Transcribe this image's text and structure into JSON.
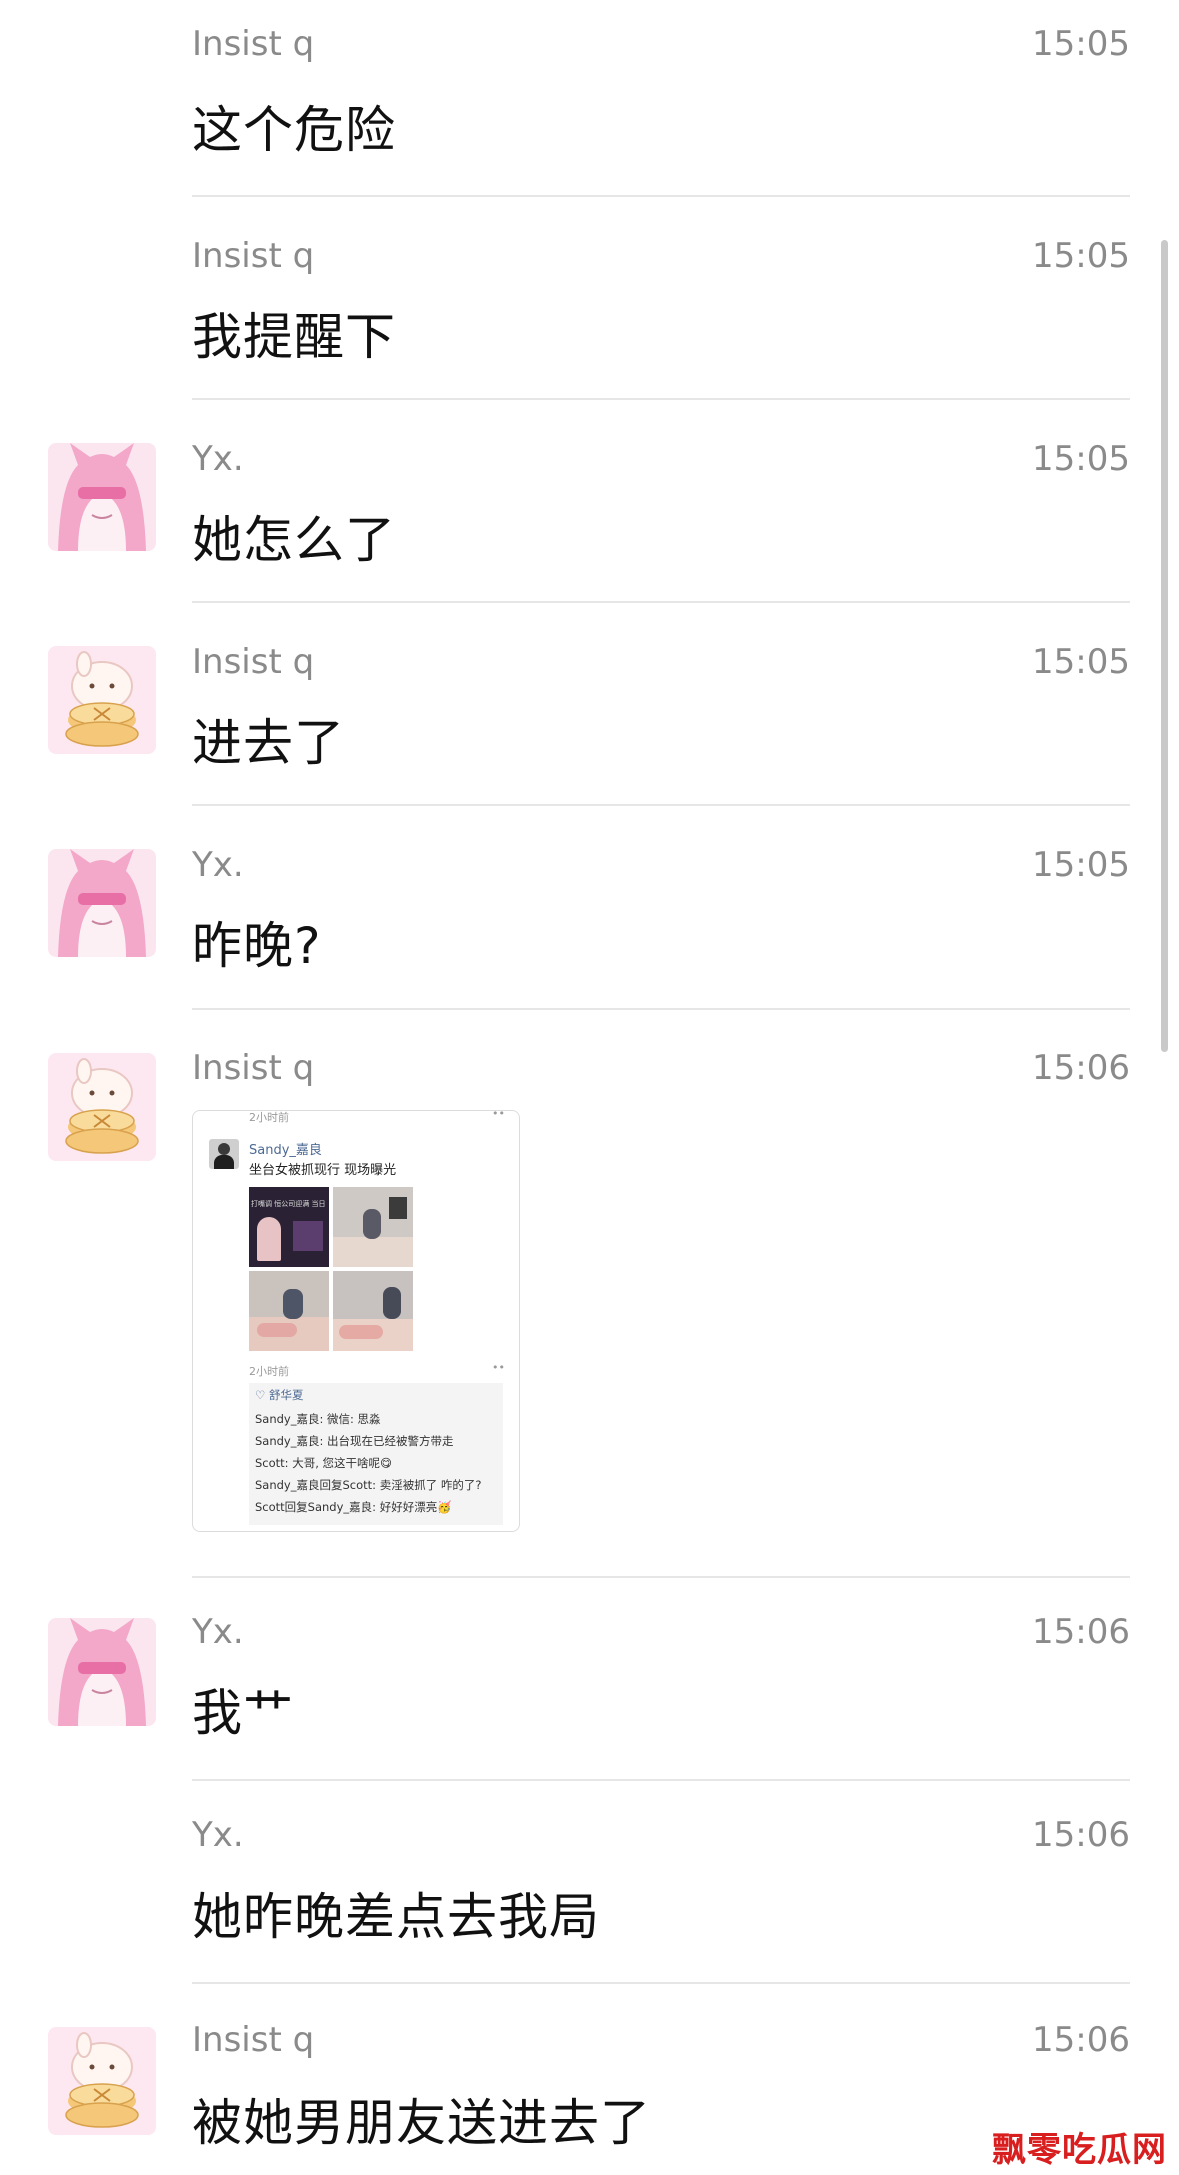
{
  "messages": [
    {
      "sender": "Insist q",
      "time": "15:05",
      "text": "这个危险",
      "avatar": "none"
    },
    {
      "sender": "Insist q",
      "time": "15:05",
      "text": "我提醒下",
      "avatar": "none"
    },
    {
      "sender": "Yx.",
      "time": "15:05",
      "text": "她怎么了",
      "avatar": "pink-cat-girl"
    },
    {
      "sender": "Insist q",
      "time": "15:05",
      "text": "进去了",
      "avatar": "bunny-pancake"
    },
    {
      "sender": "Yx.",
      "time": "15:05",
      "text": "昨晚?",
      "avatar": "pink-cat-girl"
    },
    {
      "sender": "Insist q",
      "time": "15:06",
      "text": "",
      "avatar": "bunny-pancake"
    },
    {
      "sender": "Yx.",
      "time": "15:06",
      "text": "我艹",
      "avatar": "pink-cat-girl"
    },
    {
      "sender": "Yx.",
      "time": "15:06",
      "text": "她昨晚差点去我局",
      "avatar": "none"
    },
    {
      "sender": "Insist q",
      "time": "15:06",
      "text": "被她男朋友送进去了",
      "avatar": "bunny-pancake"
    }
  ],
  "shared_image": {
    "top_time": "2小时前",
    "poster_name": "Sandy_嘉良",
    "post_text": "坐台女被抓现行 现场曝光",
    "post_time": "2小时前",
    "likes": "舒华夏",
    "comments": [
      "Sandy_嘉良: 微信: 思淼",
      "Sandy_嘉良: 出台现在已经被警方带走",
      "Scott: 大哥, 您这干啥呢😋",
      "Sandy_嘉良回复Scott: 卖淫被抓了 咋的了?",
      "Scott回复Sandy_嘉良: 好好好漂亮🥳"
    ],
    "thumb_caption": "打嘴调 恒公司迎满 当日"
  },
  "watermark": "飘零吃瓜网",
  "colors": {
    "accent": "#d81e1e",
    "meta": "#8a8a8a",
    "divider": "#e6e6e6"
  }
}
